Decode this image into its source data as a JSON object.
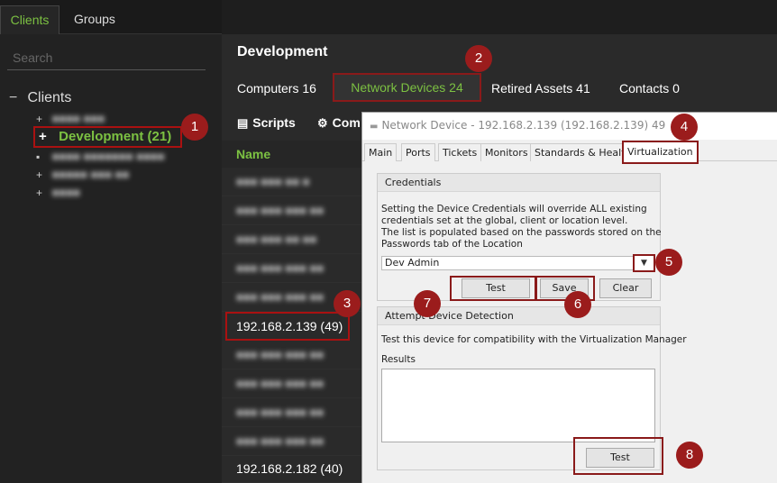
{
  "left_panel": {
    "tabs": [
      "Clients",
      "Groups"
    ],
    "search_placeholder": "Search",
    "tree": {
      "root": "Clients",
      "selected": "Development (21)"
    }
  },
  "main": {
    "title": "Development",
    "tabs": [
      "Computers 16",
      "Network Devices 24",
      "Retired Assets 41",
      "Contacts 0"
    ],
    "toolbar": [
      "Scripts",
      "Com"
    ],
    "column_header": "Name",
    "rows": [
      "192.168.2.139 (49)",
      "192.168.2.182 (40)"
    ]
  },
  "dialog": {
    "title": "Network Device - 192.168.2.139 (192.168.2.139) 49",
    "tabs": [
      "Main",
      "Ports",
      "Tickets",
      "Monitors",
      "Standards & Health",
      "Virtualization"
    ],
    "credentials": {
      "title": "Credentials",
      "text1": "Setting the Device Credentials will override ALL existing",
      "text2": "credentials set at the global, client or location level.",
      "text3": "The list is populated based on the passwords stored on the",
      "text4": "Passwords tab of the Location",
      "selected": "Dev Admin",
      "buttons": [
        "Test",
        "Save",
        "Clear"
      ]
    },
    "detection": {
      "title": "Attempt Device Detection",
      "text": "Test this device for compatibility with the Virtualization Manager",
      "results_label": "Results",
      "test_button": "Test"
    }
  },
  "badges": [
    "1",
    "2",
    "3",
    "4",
    "5",
    "6",
    "7",
    "8"
  ],
  "colors": {
    "accent": "#7cc142",
    "badge": "#9b1c1c",
    "highlight_border": "#8a1a1a"
  }
}
